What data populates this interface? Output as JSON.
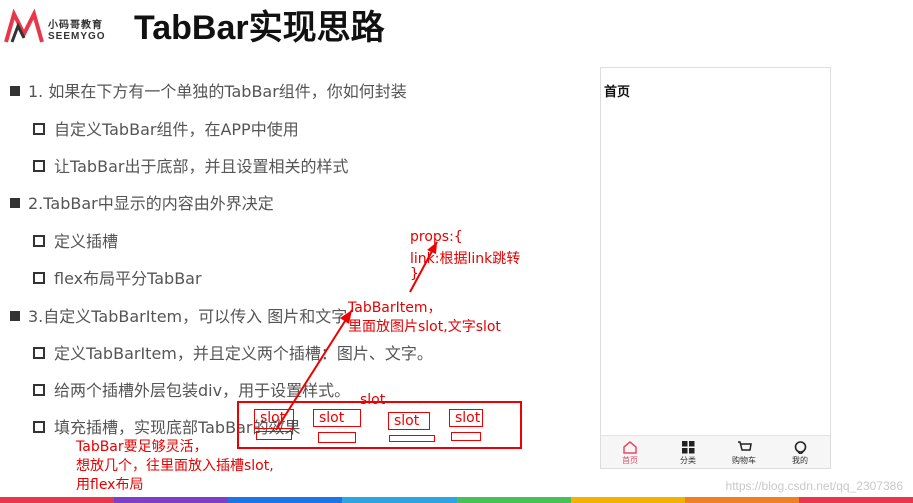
{
  "logo": {
    "cn": "小码哥教育",
    "en": "SEEMYGO"
  },
  "title": "TabBar实现思路",
  "bullets": [
    {
      "text": "1. 如果在下方有一个单独的TabBar组件，你如何封装"
    },
    {
      "text": "自定义TabBar组件，在APP中使用"
    },
    {
      "text": "让TabBar出于底部，并且设置相关的样式"
    },
    {
      "text": "2.TabBar中显示的内容由外界决定"
    },
    {
      "text": "定义插槽"
    },
    {
      "text": "flex布局平分TabBar"
    },
    {
      "text": "3.自定义TabBarItem，可以传入 图片和文字"
    },
    {
      "text": "定义TabBarItem，并且定义两个插槽：图片、文字。"
    },
    {
      "text": "给两个插槽外层包装div，用于设置样式。"
    },
    {
      "text": "填充插槽，实现底部TabBar的效果"
    }
  ],
  "annotations": {
    "props_line1": "props:{",
    "props_line2": "link:根据link跳转",
    "props_line3": "}",
    "item_line1": "TabBarItem，",
    "item_line2": "里面放图片slot,文字slot",
    "slot_top": "slot",
    "slot1": "slot",
    "slot2": "slot",
    "slot3": "slot",
    "slot4": "slot",
    "note_line1": "TabBar要足够灵活，",
    "note_line2": "想放几个，往里面放入插槽slot,",
    "note_line3": "用flex布局"
  },
  "phone": {
    "page_title": "首页",
    "tabs": [
      {
        "label": "首页",
        "icon": "home-icon",
        "active": true
      },
      {
        "label": "分类",
        "icon": "category-grid-icon",
        "active": false
      },
      {
        "label": "购物车",
        "icon": "cart-icon",
        "active": false
      },
      {
        "label": "我的",
        "icon": "profile-icon",
        "active": false
      }
    ]
  },
  "watermark": "https://blog.csdn.net/qq_2307386",
  "colors": {
    "accent_red": "#e60000",
    "active_tab": "#e84a6a",
    "stripe": [
      "#e8364a",
      "#7b3fc8",
      "#1e73e8",
      "#2aa6e0",
      "#48c057",
      "#f0b400",
      "#f08020",
      "#e8364a"
    ]
  }
}
